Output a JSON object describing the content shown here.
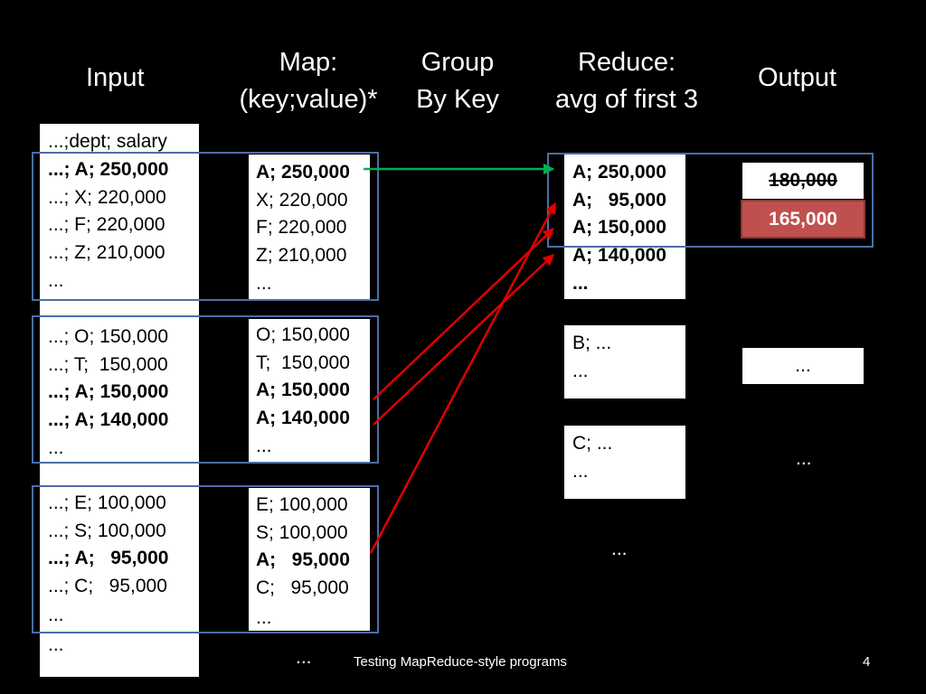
{
  "headers": {
    "input": "Input",
    "map_l1": "Map:",
    "map_l2": "(key;value)*",
    "group_l1": "Group",
    "group_l2": "By Key",
    "reduce_l1": "Reduce:",
    "reduce_l2": "avg of first 3",
    "output": "Output"
  },
  "input": {
    "header": "...;dept; salary",
    "groups": [
      [
        "...; A; 250,000",
        "...; X; 220,000",
        "...; F; 220,000",
        "...; Z; 210,000",
        "..."
      ],
      [
        "...; O; 150,000",
        "...; T;  150,000",
        "...; A; 150,000",
        "...; A; 140,000",
        "..."
      ],
      [
        "...; E; 100,000",
        "...; S; 100,000",
        "...; A;   95,000",
        "...; C;   95,000",
        "...",
        "..."
      ]
    ]
  },
  "map": {
    "groups": [
      [
        "A; 250,000",
        "X; 220,000",
        "F; 220,000",
        "Z; 210,000",
        "..."
      ],
      [
        "O; 150,000",
        "T;  150,000",
        "A; 150,000",
        "A; 140,000",
        "..."
      ],
      [
        "E; 100,000",
        "S; 100,000",
        "A;   95,000",
        "C;   95,000",
        "..."
      ]
    ]
  },
  "reduce": {
    "a": [
      "A; 250,000",
      "A;   95,000",
      "A; 150,000",
      "A; 140,000",
      "..."
    ],
    "b": [
      "B; ...",
      "..."
    ],
    "c": [
      "C; ...",
      "..."
    ],
    "more": "..."
  },
  "output": {
    "struck": "180,000",
    "result": "165,000",
    "b": "...",
    "c": "..."
  },
  "footer": {
    "dots": "...",
    "title": "Testing MapReduce-style programs",
    "page": "4"
  },
  "colors": {
    "frame": "#4a6ea8",
    "arrow_green": "#00b050",
    "arrow_red": "#e00000",
    "result_fill": "#c0504d"
  }
}
